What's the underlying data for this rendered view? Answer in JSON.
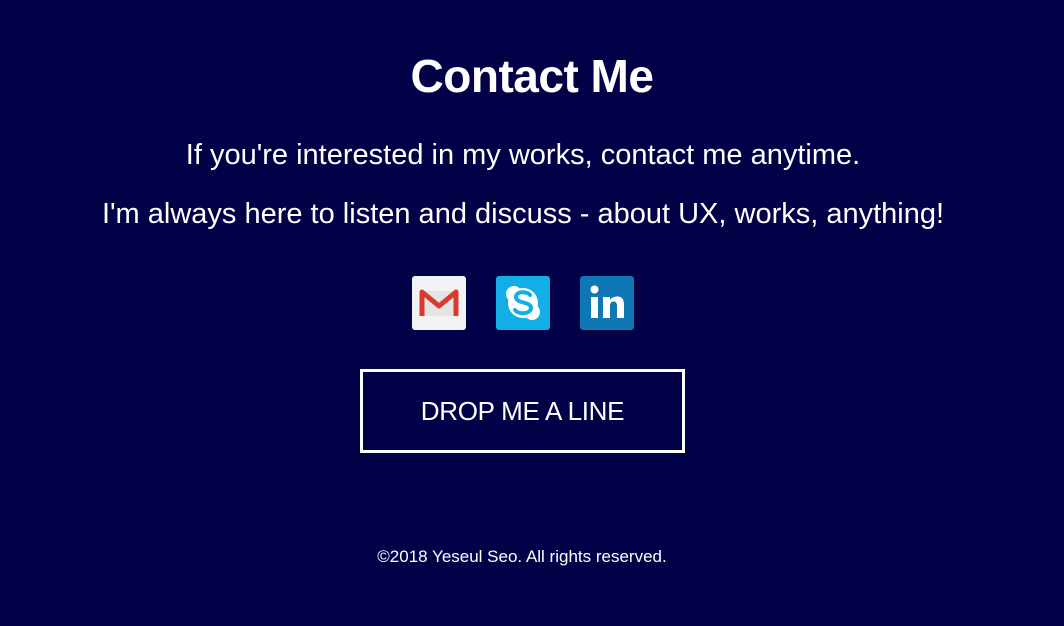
{
  "contact": {
    "title": "Contact Me",
    "lines": [
      "If you're interested in my works, contact me anytime.",
      "I'm always here to listen and discuss - about UX, works, anything!"
    ]
  },
  "social": [
    {
      "name": "gmail",
      "icon": "gmail-icon",
      "color": "#f2f2f2"
    },
    {
      "name": "skype",
      "icon": "skype-icon",
      "color": "#11aee8"
    },
    {
      "name": "linkedin",
      "icon": "linkedin-icon",
      "color": "#0f77b4"
    }
  ],
  "cta": {
    "label": "DROP ME A LINE"
  },
  "footer": {
    "copyright": "©2018 Yeseul Seo. All rights reserved."
  },
  "theme": {
    "background": "#020147",
    "text": "#ffffff"
  }
}
